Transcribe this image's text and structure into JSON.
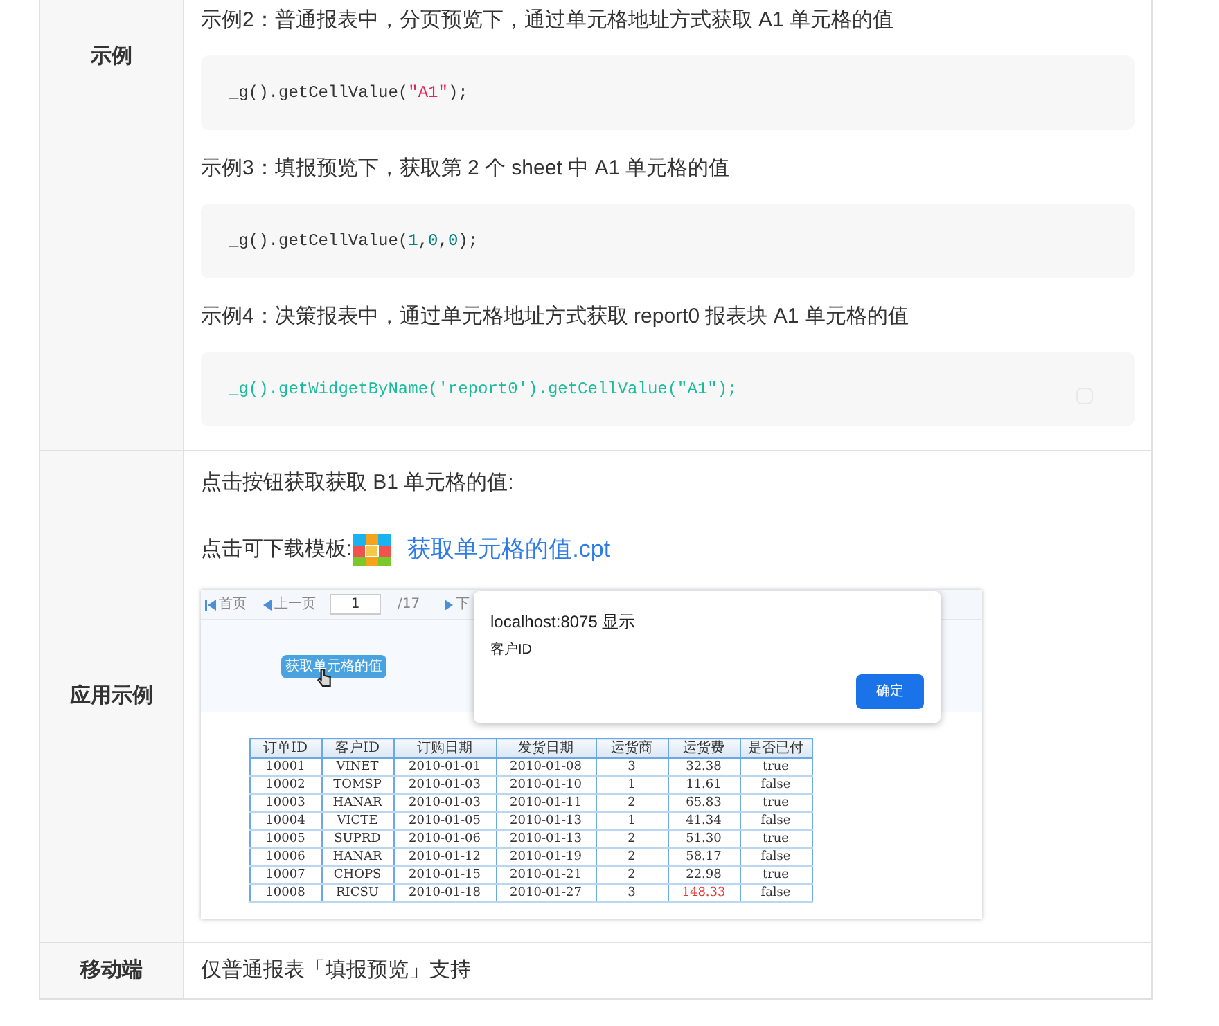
{
  "rows": [
    {
      "label": "示例",
      "kind": "examples",
      "examples": [
        {
          "caption": "示例2：普通报表中，分页预览下，通过单元格地址方式获取 A1 单元格的值",
          "code": [
            {
              "text": "_g().getCellValue(",
              "kind": "plain"
            },
            {
              "text": "\"A1\"",
              "kind": "string"
            },
            {
              "text": ");",
              "kind": "plain"
            }
          ]
        },
        {
          "caption": "示例3：填报预览下，获取第 2 个 sheet 中 A1 单元格的值",
          "code": [
            {
              "text": "_g().getCellValue(",
              "kind": "plain"
            },
            {
              "text": "1",
              "kind": "number"
            },
            {
              "text": ",",
              "kind": "plain"
            },
            {
              "text": "0",
              "kind": "number"
            },
            {
              "text": ",",
              "kind": "plain"
            },
            {
              "text": "0",
              "kind": "number"
            },
            {
              "text": ");",
              "kind": "plain"
            }
          ]
        },
        {
          "caption": "示例4：决策报表中，通过单元格地址方式获取 report0 报表块 A1 单元格的值",
          "code": [
            {
              "text": "_g().getWidgetByName('report0').getCellValue(\"A1\");",
              "kind": "teal"
            }
          ]
        }
      ]
    },
    {
      "label": "应用示例",
      "kind": "demo",
      "intro": "点击按钮获取获取 B1 单元格的值:",
      "download_label": "点击可下载模板:",
      "download_link": "获取单元格的值.cpt",
      "screenshot": {
        "toolbar": {
          "first": "首页",
          "prev": "上一页",
          "page": "1",
          "total": "/17",
          "next": "下"
        },
        "action_button": "获取单元格的值",
        "dialog": {
          "title": "localhost:8075 显示",
          "message": "客户ID",
          "ok": "确定"
        },
        "table": {
          "columns": [
            "订单ID",
            "客户ID",
            "订购日期",
            "发货日期",
            "运货商",
            "运货费",
            "是否已付"
          ],
          "rows": [
            {
              "cells": [
                "10001",
                "VINET",
                "2010-01-01",
                "2010-01-08",
                "3",
                "32.38",
                "true"
              ],
              "flagged": false
            },
            {
              "cells": [
                "10002",
                "TOMSP",
                "2010-01-03",
                "2010-01-10",
                "1",
                "11.61",
                "false"
              ],
              "flagged": false
            },
            {
              "cells": [
                "10003",
                "HANAR",
                "2010-01-03",
                "2010-01-11",
                "2",
                "65.83",
                "true"
              ],
              "flagged": false
            },
            {
              "cells": [
                "10004",
                "VICTE",
                "2010-01-05",
                "2010-01-13",
                "1",
                "41.34",
                "false"
              ],
              "flagged": false
            },
            {
              "cells": [
                "10005",
                "SUPRD",
                "2010-01-06",
                "2010-01-13",
                "2",
                "51.30",
                "true"
              ],
              "flagged": false
            },
            {
              "cells": [
                "10006",
                "HANAR",
                "2010-01-12",
                "2010-01-19",
                "2",
                "58.17",
                "false"
              ],
              "flagged": false
            },
            {
              "cells": [
                "10007",
                "CHOPS",
                "2010-01-15",
                "2010-01-21",
                "2",
                "22.98",
                "true"
              ],
              "flagged": false
            },
            {
              "cells": [
                "10008",
                "RICSU",
                "2010-01-18",
                "2010-01-27",
                "3",
                "148.33",
                "false"
              ],
              "flagged": true
            }
          ]
        }
      }
    },
    {
      "label": "移动端",
      "kind": "text",
      "text": "仅普通报表「填报预览」支持"
    }
  ]
}
